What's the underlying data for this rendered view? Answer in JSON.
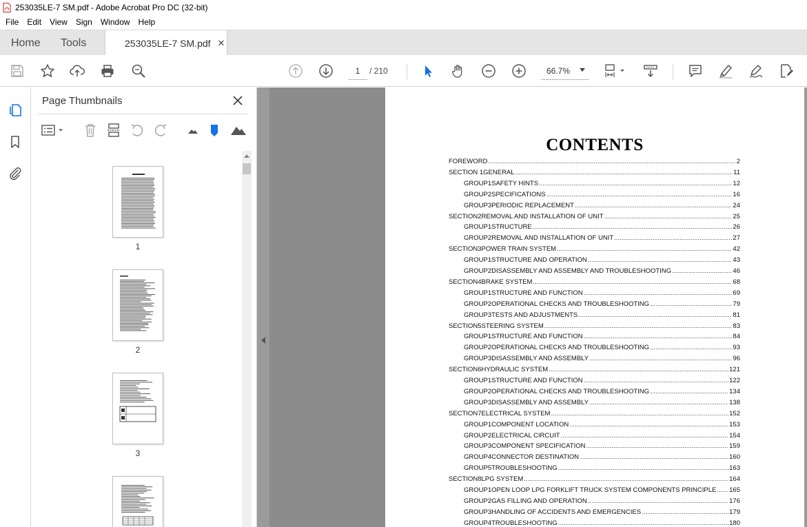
{
  "window": {
    "title": "253035LE-7 SM.pdf - Adobe Acrobat Pro DC (32-bit)",
    "icon": "pdf-icon"
  },
  "menu": [
    "File",
    "Edit",
    "View",
    "Sign",
    "Window",
    "Help"
  ],
  "tabs": {
    "home": "Home",
    "tools": "Tools",
    "document": "253035LE-7 SM.pdf",
    "close": "✕"
  },
  "toolbar": {
    "current_page": "1",
    "page_total": "/ 210",
    "zoom": "66.7%"
  },
  "panel": {
    "title": "Page Thumbnails"
  },
  "thumbnails": [
    {
      "label": "1"
    },
    {
      "label": "2"
    },
    {
      "label": "3"
    }
  ],
  "document": {
    "heading": "CONTENTS",
    "toc": [
      {
        "sec": "FOREWORD",
        "grp": "",
        "title": "",
        "page": "2"
      },
      {
        "sec": "SECTION 1",
        "grp": "",
        "title": "GENERAL",
        "page": "11"
      },
      {
        "sec": "",
        "grp": "GROUP1",
        "title": "SAFETY HINTS",
        "page": "12"
      },
      {
        "sec": "",
        "grp": "GROUP2",
        "title": "SPECIFICATIONS",
        "page": "16"
      },
      {
        "sec": "",
        "grp": "GROUP3",
        "title": "PERIODIC REPLACEMENT",
        "page": "24"
      },
      {
        "sec": "SECTION2",
        "grp": "",
        "title": "REMOVAL AND INSTALLATION OF UNIT",
        "page": "25"
      },
      {
        "sec": "",
        "grp": "GROUP1",
        "title": "STRUCTURE",
        "page": "26"
      },
      {
        "sec": "",
        "grp": "GROUP2",
        "title": "REMOVAL AND INSTALLATION OF UNIT",
        "page": "27"
      },
      {
        "sec": "SECTION3",
        "grp": "",
        "title": "POWER TRAIN SYSTEM",
        "page": "42"
      },
      {
        "sec": "",
        "grp": "GROUP1",
        "title": "STRUCTURE AND OPERATION",
        "page": "43"
      },
      {
        "sec": "",
        "grp": "GROUP2",
        "title": "DISASSEMBLY AND ASSEMBLY AND TROUBLESHOOTING",
        "page": "46"
      },
      {
        "sec": "SECTION4",
        "grp": "",
        "title": "BRAKE SYSTEM",
        "page": "68"
      },
      {
        "sec": "",
        "grp": "GROUP1",
        "title": "STRUCTURE AND FUNCTION",
        "page": "69"
      },
      {
        "sec": "",
        "grp": "GROUP2",
        "title": "OPERATIONAL CHECKS AND TROUBLESHOOTING",
        "page": "79"
      },
      {
        "sec": "",
        "grp": "GROUP3",
        "title": "TESTS AND ADJUSTMENTS",
        "page": "81"
      },
      {
        "sec": "SECTION5",
        "grp": "",
        "title": "STEERING SYSTEM",
        "page": "83"
      },
      {
        "sec": "",
        "grp": "GROUP1",
        "title": "STRUCTURE AND FUNCTION",
        "page": "84"
      },
      {
        "sec": "",
        "grp": "GROUP2",
        "title": "OPERATIONAL CHECKS AND TROUBLESHOOTING",
        "page": "93"
      },
      {
        "sec": "",
        "grp": "GROUP3",
        "title": "DISASSEMBLY AND ASSEMBLY",
        "page": "96"
      },
      {
        "sec": "SECTION6",
        "grp": "",
        "title": "HYDRAULIC SYSTEM",
        "page": "121"
      },
      {
        "sec": "",
        "grp": "GROUP1",
        "title": "STRUCTURE AND FUNCTION",
        "page": "122"
      },
      {
        "sec": "",
        "grp": "GROUP2",
        "title": "OPERATIONAL CHECKS AND TROUBLESHOOTING",
        "page": "134"
      },
      {
        "sec": "",
        "grp": "GROUP3",
        "title": "DISASSEMBLY AND ASSEMBLY",
        "page": "138"
      },
      {
        "sec": "SECTION7",
        "grp": "",
        "title": "ELECTRICAL SYSTEM",
        "page": "152"
      },
      {
        "sec": "",
        "grp": "GROUP1",
        "title": "COMPONENT LOCATION",
        "page": "153"
      },
      {
        "sec": "",
        "grp": "GROUP2",
        "title": "ELECTRICAL CIRCUIT",
        "page": "154"
      },
      {
        "sec": "",
        "grp": "GROUP3",
        "title": "COMPONENT SPECIFICATION",
        "page": "159"
      },
      {
        "sec": "",
        "grp": "GROUP4",
        "title": "CONNECTOR DESTINATION",
        "page": "160"
      },
      {
        "sec": "",
        "grp": "GROUP5",
        "title": "TROUBLESHOOTING",
        "page": "163"
      },
      {
        "sec": "SECTION8",
        "grp": "",
        "title": "LPG SYSTEM",
        "page": "164"
      },
      {
        "sec": "",
        "grp": "GROUP1",
        "title": "OPEN LOOP LPG FORKLIFT TRUCK SYSTEM COMPONENTS PRINCIPLE",
        "page": "165"
      },
      {
        "sec": "",
        "grp": "GROUP2",
        "title": "GAS FILLING AND OPERATION",
        "page": "176"
      },
      {
        "sec": "",
        "grp": "GROUP3",
        "title": "HANDLING OF ACCIDENTS AND EMERGENCIES",
        "page": "179"
      },
      {
        "sec": "",
        "grp": "GROUP4",
        "title": "TROUBLESHOOTING",
        "page": "180"
      }
    ]
  },
  "colors": {
    "accent": "#1473e6",
    "pdf_red": "#d21d1d",
    "doc_bg": "#9b9b9b"
  }
}
